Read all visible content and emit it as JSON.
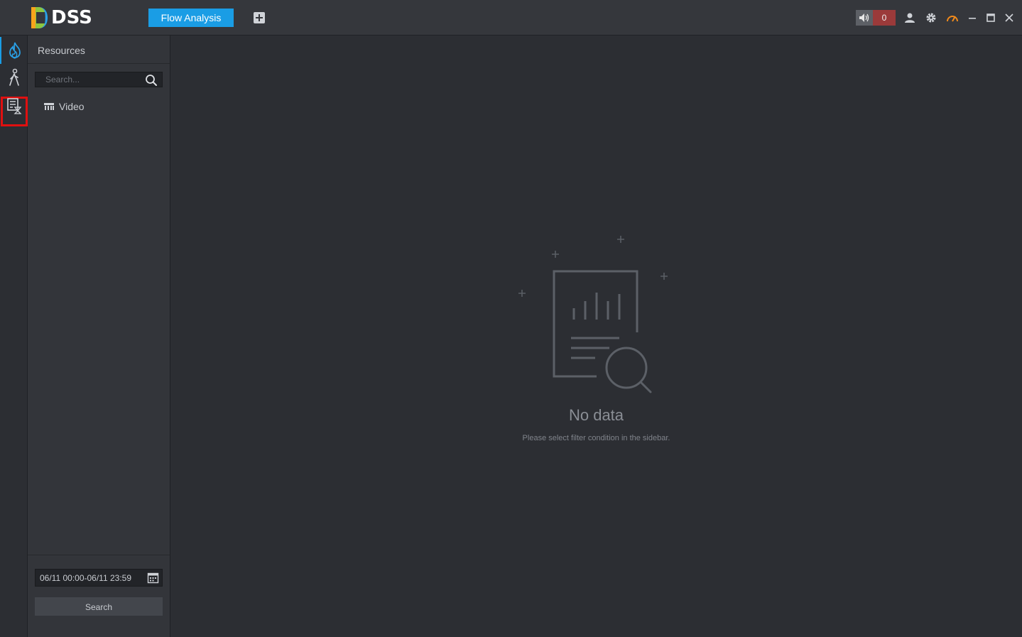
{
  "app": {
    "logo_text": "DSS"
  },
  "header": {
    "active_tab": "Flow Analysis",
    "alarm_count": "0",
    "icons": [
      "speaker-icon",
      "user-icon",
      "gear-icon",
      "speedometer-icon",
      "minimize-icon",
      "maximize-icon",
      "close-icon"
    ]
  },
  "rail": {
    "items": [
      {
        "icon": "heat-flame-icon",
        "active": true
      },
      {
        "icon": "pedestrian-walk-icon",
        "active": false,
        "highlighted": true
      },
      {
        "icon": "report-list-icon",
        "active": false
      }
    ]
  },
  "resources": {
    "title": "Resources",
    "search_placeholder": "Search...",
    "tree": [
      {
        "icon": "video-device-icon",
        "label": "Video"
      }
    ],
    "date_range": "06/11 00:00-06/11 23:59",
    "search_button": "Search"
  },
  "main": {
    "empty_title": "No data",
    "empty_hint": "Please select filter condition in the sidebar."
  },
  "colors": {
    "accent": "#1a9de5",
    "alarm": "#9b3a3a",
    "highlight": "#e01010",
    "background": "#2c2e33"
  }
}
